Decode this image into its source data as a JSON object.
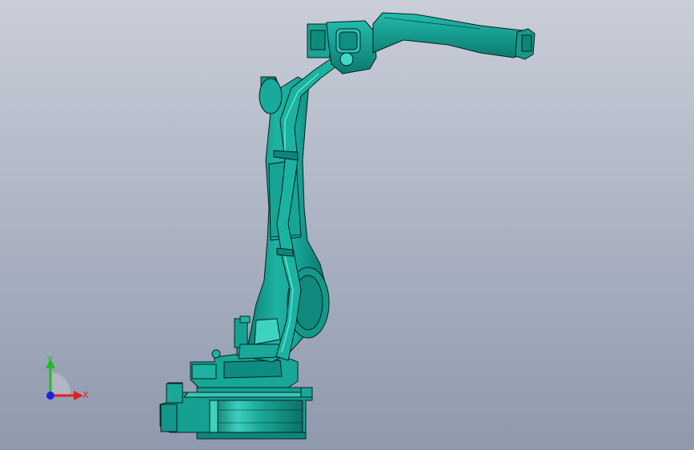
{
  "viewport": {
    "background_top": "#c9ced8",
    "background_bottom": "#8e99ad",
    "model_color": "#11a597",
    "model_highlight": "#5fd6c6",
    "model_shadow": "#0a7468",
    "edge_color": "#0b1f1d"
  },
  "triad": {
    "x_label": "X",
    "y_label": "Y",
    "x_color": "#e02020",
    "y_color": "#22bb22",
    "z_color": "#2020e0"
  }
}
